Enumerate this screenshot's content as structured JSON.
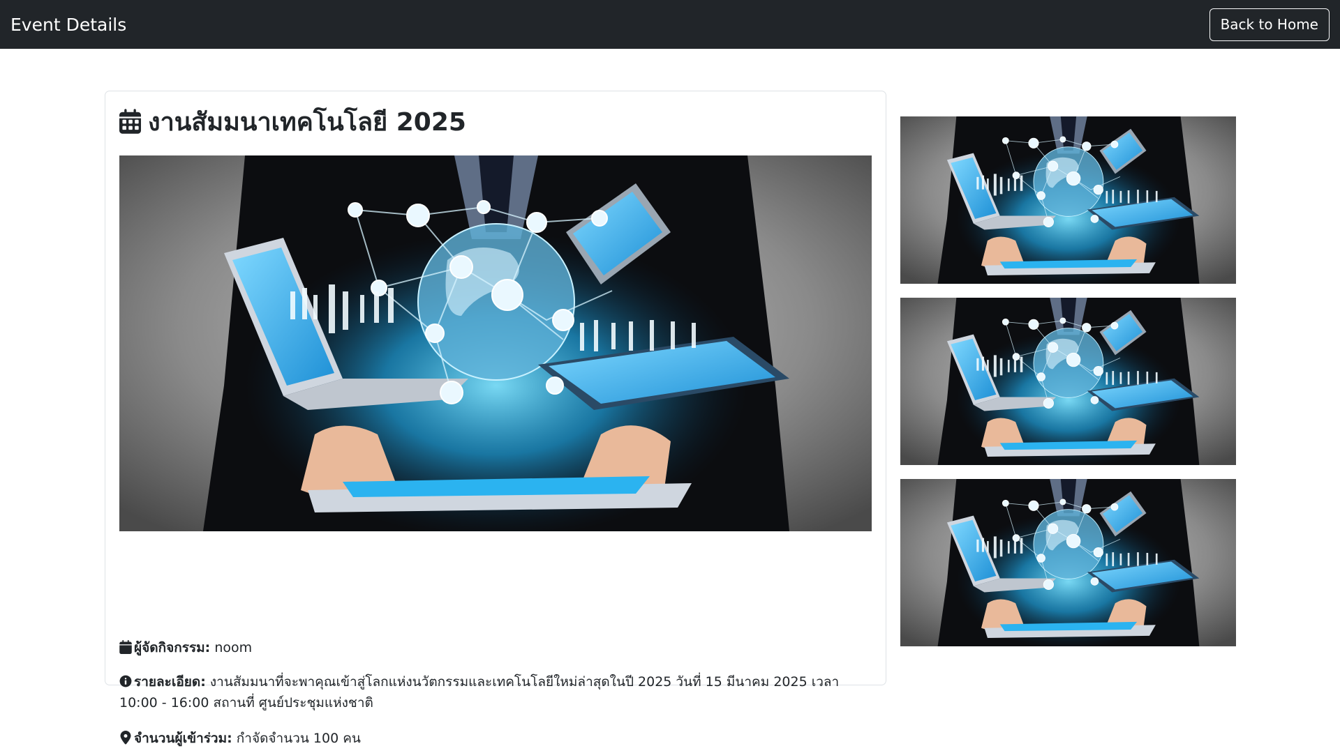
{
  "navbar": {
    "title": "Event Details",
    "back_label": "Back to Home"
  },
  "event": {
    "title": "งานสัมมนาเทคโนโลยี 2025",
    "organizer_label": "ผู้จัดกิจกรรม:",
    "organizer_value": "noom",
    "detail_label": "รายละเอียด:",
    "detail_value": "งานสัมมนาที่จะพาคุณเข้าสู่โลกแห่งนวัตกรรมและเทคโนโลยีใหม่ล่าสุดในปี 2025 วันที่ 15 มีนาคม 2025 เวลา 10:00 - 16:00 สถานที่ ศูนย์ประชุมแห่งชาติ",
    "capacity_label": "จำนวนผู้เข้าร่วม:",
    "capacity_value": "กำจัดจำนวน 100 คน"
  },
  "icons": {
    "title": "calendar-icon",
    "organizer": "calendar-icon",
    "detail": "info-circle-icon",
    "capacity": "map-pin-icon"
  },
  "colors": {
    "navbar": "#212529",
    "accent_glow": "#29b6f6",
    "text": "#212529"
  }
}
